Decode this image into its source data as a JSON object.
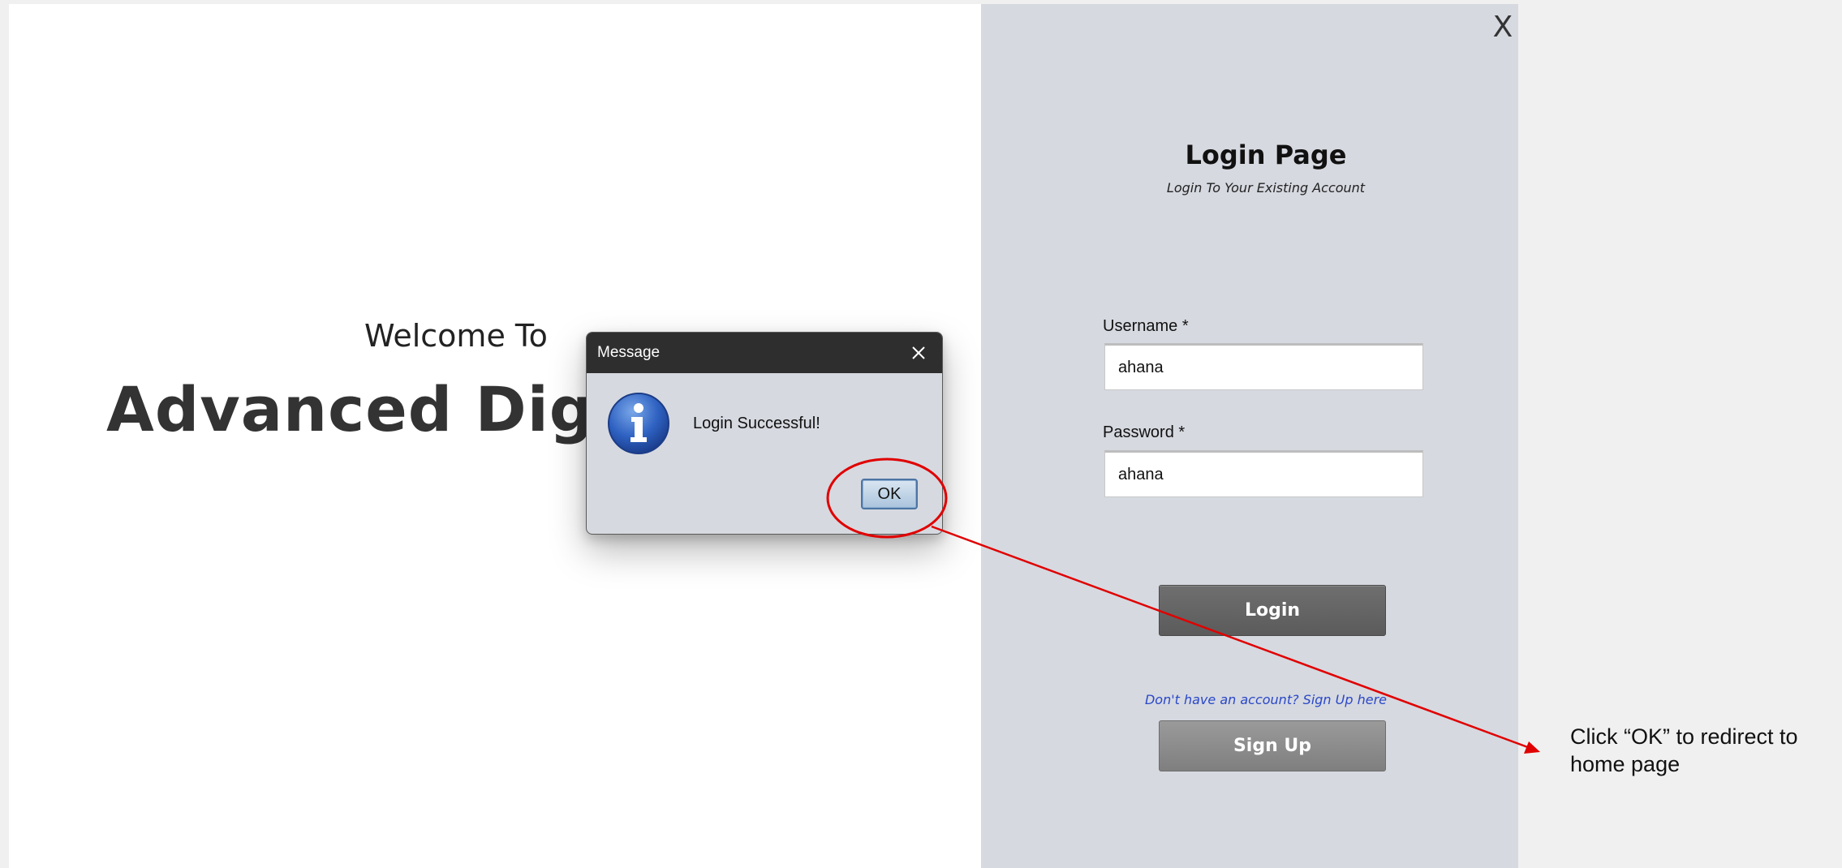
{
  "window": {
    "close_label": "X"
  },
  "welcome": {
    "welcome_to": "Welcome To",
    "app_name": "Advanced Digit"
  },
  "login": {
    "title": "Login Page",
    "subtitle": "Login To Your Existing Account",
    "username_label": "Username *",
    "username_value": "ahana",
    "password_label": "Password *",
    "password_value": "ahana",
    "login_button": "Login",
    "signup_prompt": "Don't have an account? Sign Up here",
    "signup_button": "Sign Up"
  },
  "dialog": {
    "title": "Message",
    "message": "Login Successful!",
    "ok_button": "OK",
    "icon": "info-icon"
  },
  "annotation": {
    "text": "Click “OK” to redirect to home page",
    "color": "#e00000"
  },
  "colors": {
    "login_pane_bg": "#d6d9e0",
    "dialog_titlebar": "#2e2e2e",
    "link": "#2a48c8",
    "annotation_red": "#e00000"
  }
}
